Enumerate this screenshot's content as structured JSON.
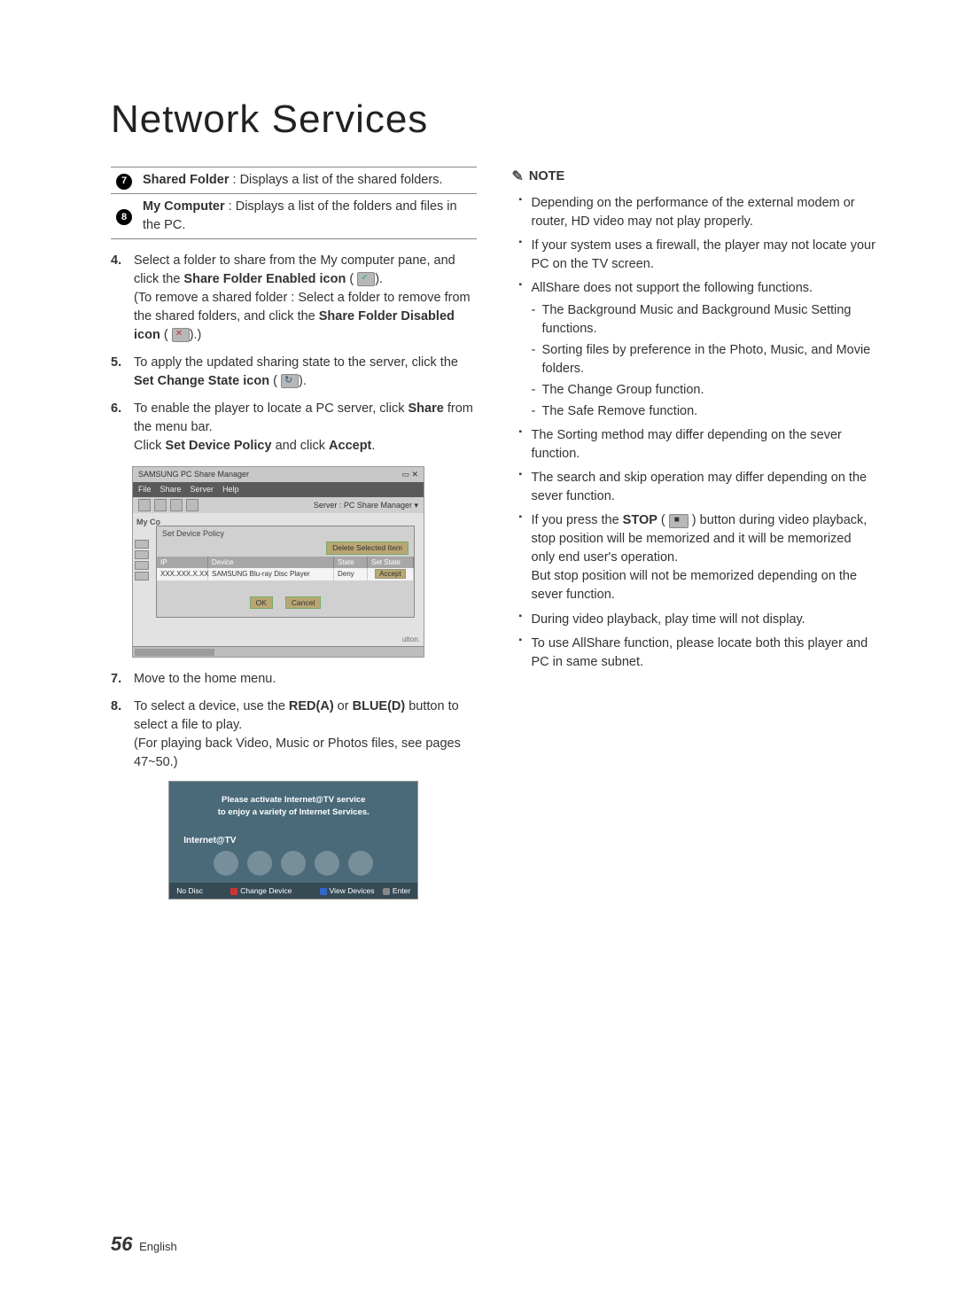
{
  "page": {
    "title": "Network Services",
    "page_number": "56",
    "language": "English"
  },
  "definitions": [
    {
      "num": "7",
      "term": "Shared Folder",
      "desc": " : Displays a list of the shared folders."
    },
    {
      "num": "8",
      "term": "My Computer",
      "desc": " : Displays a list of the folders and files in the PC."
    }
  ],
  "steps_a": [
    {
      "n": "4.",
      "parts": [
        "Select a folder to share from the My computer pane, and click the ",
        "Share Folder Enabled icon",
        " ( ",
        ").",
        "(To remove a shared folder : Select a folder to remove from the shared folders, and click the ",
        "Share Folder Disabled icon",
        " ( ",
        ").)"
      ],
      "icon1": "enabled",
      "icon2": "disabled"
    },
    {
      "n": "5.",
      "parts": [
        "To apply the updated sharing state to the server, click the ",
        "Set Change State icon",
        " ( ",
        ")."
      ],
      "icon1": "refresh"
    },
    {
      "n": "6.",
      "parts": [
        "To enable the player to locate a PC server, click ",
        "Share",
        " from the menu bar.",
        "Click ",
        "Set Device Policy",
        " and click ",
        "Accept",
        "."
      ]
    }
  ],
  "shot1": {
    "window_title": "SAMSUNG PC Share Manager",
    "menus": [
      "File",
      "Share",
      "Server",
      "Help"
    ],
    "server_label": "Server : PC Share Manager ▾",
    "side_label": "My Co",
    "dialog_title": "Set Device Policy",
    "delete_btn": "Delete Selected Item",
    "cols": {
      "ip": "IP",
      "device": "Device",
      "state": "State",
      "set": "Set State"
    },
    "row": {
      "ip": "XXX.XXX.X.XX",
      "device": "SAMSUNG Blu-ray Disc Player",
      "state": "Deny",
      "accept": "Accept"
    },
    "ok": "OK",
    "cancel": "Cancel",
    "right_label": "utton."
  },
  "steps_b": [
    {
      "n": "7.",
      "text": "Move to the home menu."
    },
    {
      "n": "8.",
      "pre": "To select a device, use the ",
      "red": "RED(A)",
      "mid": " or ",
      "blue": "BLUE(D)",
      "post": " button to select a file to play.",
      "line2": "(For playing back Video, Music or Photos files, see pages 47~50.)"
    }
  ],
  "shot2": {
    "banner1": "Please activate Internet@TV service",
    "banner2": "to enjoy a variety of Internet Services.",
    "label": "Internet@TV",
    "foot": {
      "left": "No Disc",
      "a": "Change Device",
      "d": "View Devices",
      "enter": "Enter"
    }
  },
  "note_label": "NOTE",
  "notes": [
    {
      "text": "Depending on the performance of the external modem or router, HD video may not play properly."
    },
    {
      "text": "If your system uses a firewall, the player may not locate your PC on the TV screen."
    },
    {
      "text": "AllShare does not support the following functions.",
      "sub": [
        "The Background Music and Background Music Setting functions.",
        "Sorting files by preference in the Photo, Music, and Movie folders.",
        "The Change Group function.",
        "The Safe Remove function."
      ]
    },
    {
      "text": "The Sorting method may differ depending on the sever function."
    },
    {
      "text": "The search and skip operation may differ depending on the sever function."
    },
    {
      "pre": "If you press the ",
      "bold": "STOP",
      "mid": " ( ",
      "post": " ) button during video playback, stop position will be memorized and it will be memorized only end user's operation.",
      "line2": "But stop position will not be memorized depending on the sever function.",
      "icon": "stop"
    },
    {
      "text": "During video playback, play time will not display."
    },
    {
      "text": "To use AllShare function, please locate both this player and PC in same subnet."
    }
  ]
}
